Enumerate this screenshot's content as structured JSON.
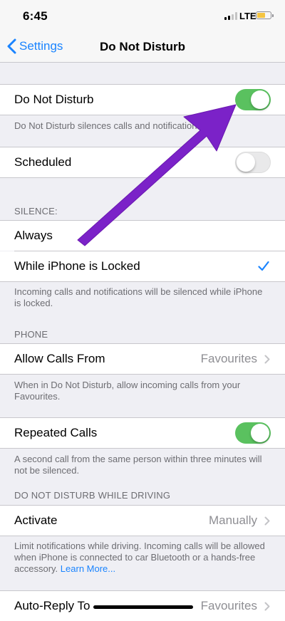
{
  "status_bar": {
    "time": "6:45",
    "network": "LTE"
  },
  "nav": {
    "back_label": "Settings",
    "title": "Do Not Disturb"
  },
  "do_not_disturb": {
    "label": "Do Not Disturb",
    "enabled": true,
    "footer": "Do Not Disturb silences calls and notifications"
  },
  "scheduled": {
    "label": "Scheduled",
    "enabled": false
  },
  "silence": {
    "header": "SILENCE:",
    "options": [
      {
        "label": "Always",
        "selected": false
      },
      {
        "label": "While iPhone is Locked",
        "selected": true
      }
    ],
    "footer": "Incoming calls and notifications will be silenced while iPhone is locked."
  },
  "phone": {
    "header": "PHONE",
    "allow_calls": {
      "label": "Allow Calls From",
      "value": "Favourites"
    },
    "allow_footer": "When in Do Not Disturb, allow incoming calls from your Favourites.",
    "repeated_calls": {
      "label": "Repeated Calls",
      "enabled": true
    },
    "repeated_footer": "A second call from the same person within three minutes will not be silenced."
  },
  "driving": {
    "header": "DO NOT DISTURB WHILE DRIVING",
    "activate": {
      "label": "Activate",
      "value": "Manually"
    },
    "footer": "Limit notifications while driving. Incoming calls will be allowed when iPhone is connected to car Bluetooth or a hands-free accessory.",
    "learn_more": "Learn More...",
    "auto_reply": {
      "label": "Auto-Reply To",
      "value": "Favourites"
    }
  },
  "colors": {
    "accent": "#1a84ff",
    "toggle_on": "#5ac15f",
    "annotation_arrow": "#7b22c8",
    "background": "#efeff4"
  }
}
